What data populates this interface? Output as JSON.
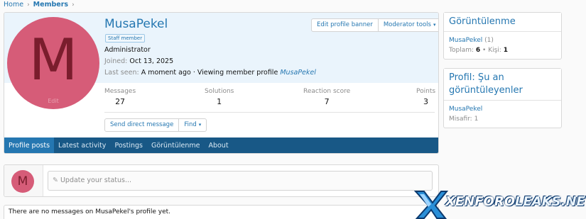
{
  "breadcrumb": {
    "home": "Home",
    "members": "Members"
  },
  "profile": {
    "username": "MusaPekel",
    "badge": "Staff member",
    "role": "Administrator",
    "joined_label": "Joined:",
    "joined_value": "Oct 13, 2025",
    "last_seen_label": "Last seen:",
    "last_seen_value": "A moment ago · Viewing member profile",
    "last_seen_link": "MusaPekel",
    "avatar_letter": "M",
    "avatar_edit": "Edit",
    "avatar_color": "#d65c78",
    "edit_banner_button": "Edit profile banner",
    "moderator_tools_button": "Moderator tools",
    "send_dm_button": "Send direct message",
    "find_button": "Find"
  },
  "stats": [
    {
      "label": "Messages",
      "value": "27"
    },
    {
      "label": "Solutions",
      "value": "1"
    },
    {
      "label": "Reaction score",
      "value": "7"
    },
    {
      "label": "Points",
      "value": "3"
    }
  ],
  "tabs": [
    "Profile posts",
    "Latest activity",
    "Postings",
    "Görüntülenme",
    "About"
  ],
  "status": {
    "avatar_letter": "M",
    "placeholder": "Update your status..."
  },
  "no_messages": "There are no messages on MusaPekel's profile yet.",
  "sidebar": {
    "views": {
      "title": "Görüntülenme",
      "user": "MusaPekel",
      "user_count": "(1)",
      "total_label": "Toplam:",
      "total_value": "6",
      "persons_label": "Kişi:",
      "persons_value": "1"
    },
    "viewers": {
      "title": "Profil: Şu an görüntüleyenler",
      "user": "MusaPekel",
      "guest_label": "Misafir:",
      "guest_value": "1"
    }
  },
  "watermark": {
    "brand": "XENFORO",
    "brand2": "LEAKS.NET"
  },
  "colors": {
    "accent": "#2577b1",
    "tab_bar": "#185886",
    "banner": "#eaf4fc"
  }
}
